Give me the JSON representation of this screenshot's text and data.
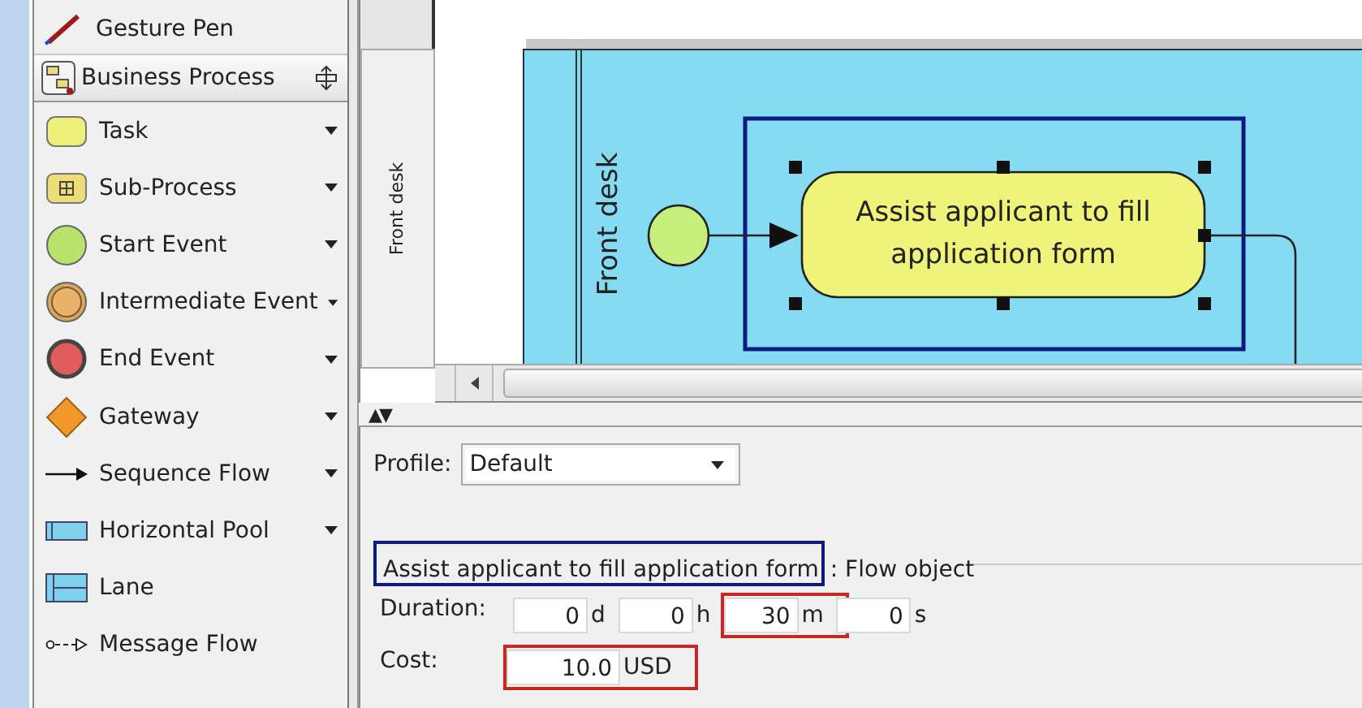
{
  "palette": {
    "top_item": {
      "label": "Gesture Pen"
    },
    "section": {
      "title": "Business Process"
    },
    "items": [
      {
        "kind": "task",
        "label": "Task",
        "dropdown": true
      },
      {
        "kind": "subprocess",
        "label": "Sub-Process",
        "dropdown": true
      },
      {
        "kind": "start",
        "label": "Start Event",
        "dropdown": true
      },
      {
        "kind": "intermediate",
        "label": "Intermediate Event",
        "dropdown": true
      },
      {
        "kind": "end",
        "label": "End Event",
        "dropdown": true
      },
      {
        "kind": "gateway",
        "label": "Gateway",
        "dropdown": true
      },
      {
        "kind": "sequence",
        "label": "Sequence Flow",
        "dropdown": true
      },
      {
        "kind": "pool",
        "label": "Horizontal Pool",
        "dropdown": true
      },
      {
        "kind": "lane",
        "label": "Lane",
        "dropdown": false
      },
      {
        "kind": "message",
        "label": "Message Flow",
        "dropdown": false
      }
    ]
  },
  "lane_tab": {
    "label": "Front desk"
  },
  "diagram": {
    "lane_label": "Front desk",
    "task": {
      "lines": [
        "Assist applicant to fill",
        "application form"
      ],
      "selected": true
    }
  },
  "splitter": {
    "label": "▲▼"
  },
  "properties": {
    "profile": {
      "label": "Profile:",
      "value": "Default"
    },
    "title": {
      "name": "Assist applicant to fill application form",
      "highlighted": true,
      "suffix": ": Flow object"
    },
    "duration": {
      "label": "Duration:",
      "fields": [
        {
          "value": "0",
          "unit": "d",
          "highlighted": false
        },
        {
          "value": "0",
          "unit": "h",
          "highlighted": false
        },
        {
          "value": "30",
          "unit": "m",
          "highlighted": true
        },
        {
          "value": "0",
          "unit": "s",
          "highlighted": false
        }
      ]
    },
    "cost": {
      "label": "Cost:",
      "value": "10.0",
      "unit": "USD",
      "highlighted": true
    }
  }
}
